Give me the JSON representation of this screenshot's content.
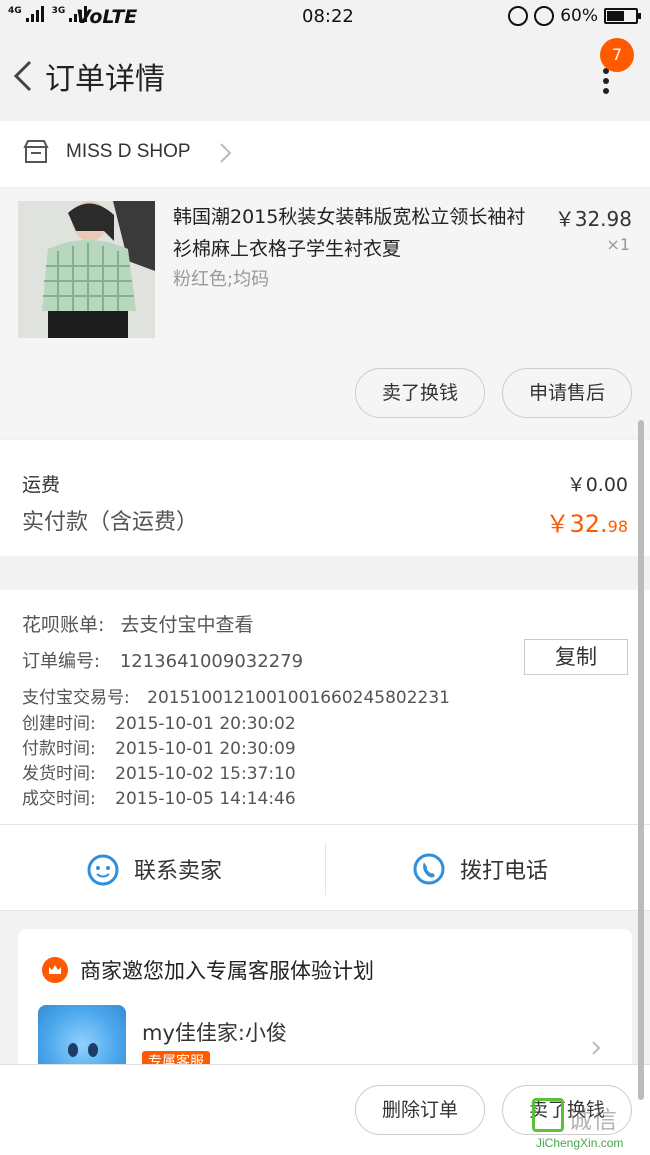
{
  "status_bar": {
    "network_1": "4G",
    "network_2": "3G",
    "volte": "VoLTE",
    "time": "08:22",
    "battery_percent": "60%",
    "battery_level": 0.6
  },
  "header": {
    "title": "订单详情",
    "notification_count": "7"
  },
  "shop": {
    "name": "MISS D SHOP"
  },
  "product": {
    "title": "韩国潮2015秋装女装韩版宽松立领长袖衬衫棉麻上衣格子学生衬衣夏",
    "sku": "粉红色;均码",
    "price": "￥32.98",
    "quantity": "×1",
    "action_sell": "卖了换钱",
    "action_aftersale": "申请售后"
  },
  "fees": {
    "shipping_label": "运费",
    "shipping_value": "￥0.00",
    "paid_label": "实付款（含运费）",
    "paid_value_main": "￥32.",
    "paid_value_cents": "98"
  },
  "order_info": {
    "huabei_label": "花呗账单:",
    "huabei_value": "去支付宝中查看",
    "order_no_label": "订单编号:",
    "order_no_value": "1213641009032279",
    "copy_label": "复制",
    "alipay_label": "支付宝交易号:",
    "alipay_value": "2015100121001001660245802231",
    "created_label": "创建时间:",
    "created_value": "2015-10-01 20:30:02",
    "paid_label": "付款时间:",
    "paid_value": "2015-10-01 20:30:09",
    "shipped_label": "发货时间:",
    "shipped_value": "2015-10-02 15:37:10",
    "done_label": "成交时间:",
    "done_value": "2015-10-05 14:14:46"
  },
  "contact": {
    "seller_label": "联系卖家",
    "phone_label": "拨打电话"
  },
  "service_card": {
    "title": "商家邀您加入专属客服体验计划",
    "agent_name": "my佳佳家:小俊",
    "agent_tag": "专属客服"
  },
  "bottom_bar": {
    "delete_label": "删除订单",
    "sell_label": "卖了换钱"
  },
  "watermark": {
    "text": "诚信",
    "url": "JiChengXin.com"
  },
  "colors": {
    "accent": "#ff5a00",
    "icon_blue": "#2f8fdc",
    "background": "#f2f2f2"
  }
}
